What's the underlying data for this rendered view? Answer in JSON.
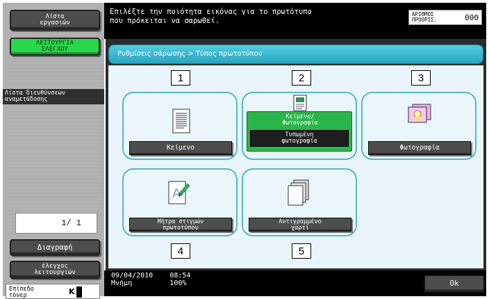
{
  "sidebar": {
    "job_list_label": "Λίστα\nεργασιών",
    "check_function_label": "ΛΕΙΤΟΥΡΓΙΑ\nΕΛΕΓΧΟΥ",
    "address_list_label": "Λίστα διευθύνσεων\nαναμετάδοσης",
    "page_counter": "1/  1",
    "delete_label": "Διαγραφή",
    "check_details_label": "έλεγχος\nλειτουργιών",
    "toner_label": "Επίπεδο\nτόνερ",
    "toner_color": "K"
  },
  "header": {
    "instruction": "Επιλέξτε την ποιότητα εικόνας για το πρωτότυπο\nπου πρόκειται να σαρωθεί.",
    "copies_label": "ΑΡΙΘΜΟΣ\nΠΡΟΟΡΙΣ.",
    "copies_value": "000"
  },
  "breadcrumb": "Ρυθμίσεις σάρωσης > Τύπος πρωτοτύπου",
  "options": [
    {
      "number": "1",
      "label": "Κείμενο",
      "icon": "text-document-icon"
    },
    {
      "number": "2",
      "label": "Κείμενο/\nΦωτογραφία",
      "sub_label": "Τυπωμένη\nφωτογραφία",
      "icon": "text-photo-document-icon",
      "selected": true
    },
    {
      "number": "3",
      "label": "Φωτογραφία",
      "icon": "photo-icon"
    },
    {
      "number": "4",
      "label": "Μήτρα στιγμών\nπρωτοτύπου",
      "icon": "dot-matrix-document-icon"
    },
    {
      "number": "5",
      "label": "Αντιγραμμένο\nχαρτί",
      "icon": "copied-paper-icon"
    }
  ],
  "status": {
    "date": "09/04/2010",
    "time": "08:54",
    "memory_label": "Μνήμη",
    "memory_value": "100%"
  },
  "ok_label": "Ok",
  "colors": {
    "accent": "#2aa5bd",
    "selected": "#2ab54a",
    "sidebar_button": "#4d4d4d"
  }
}
